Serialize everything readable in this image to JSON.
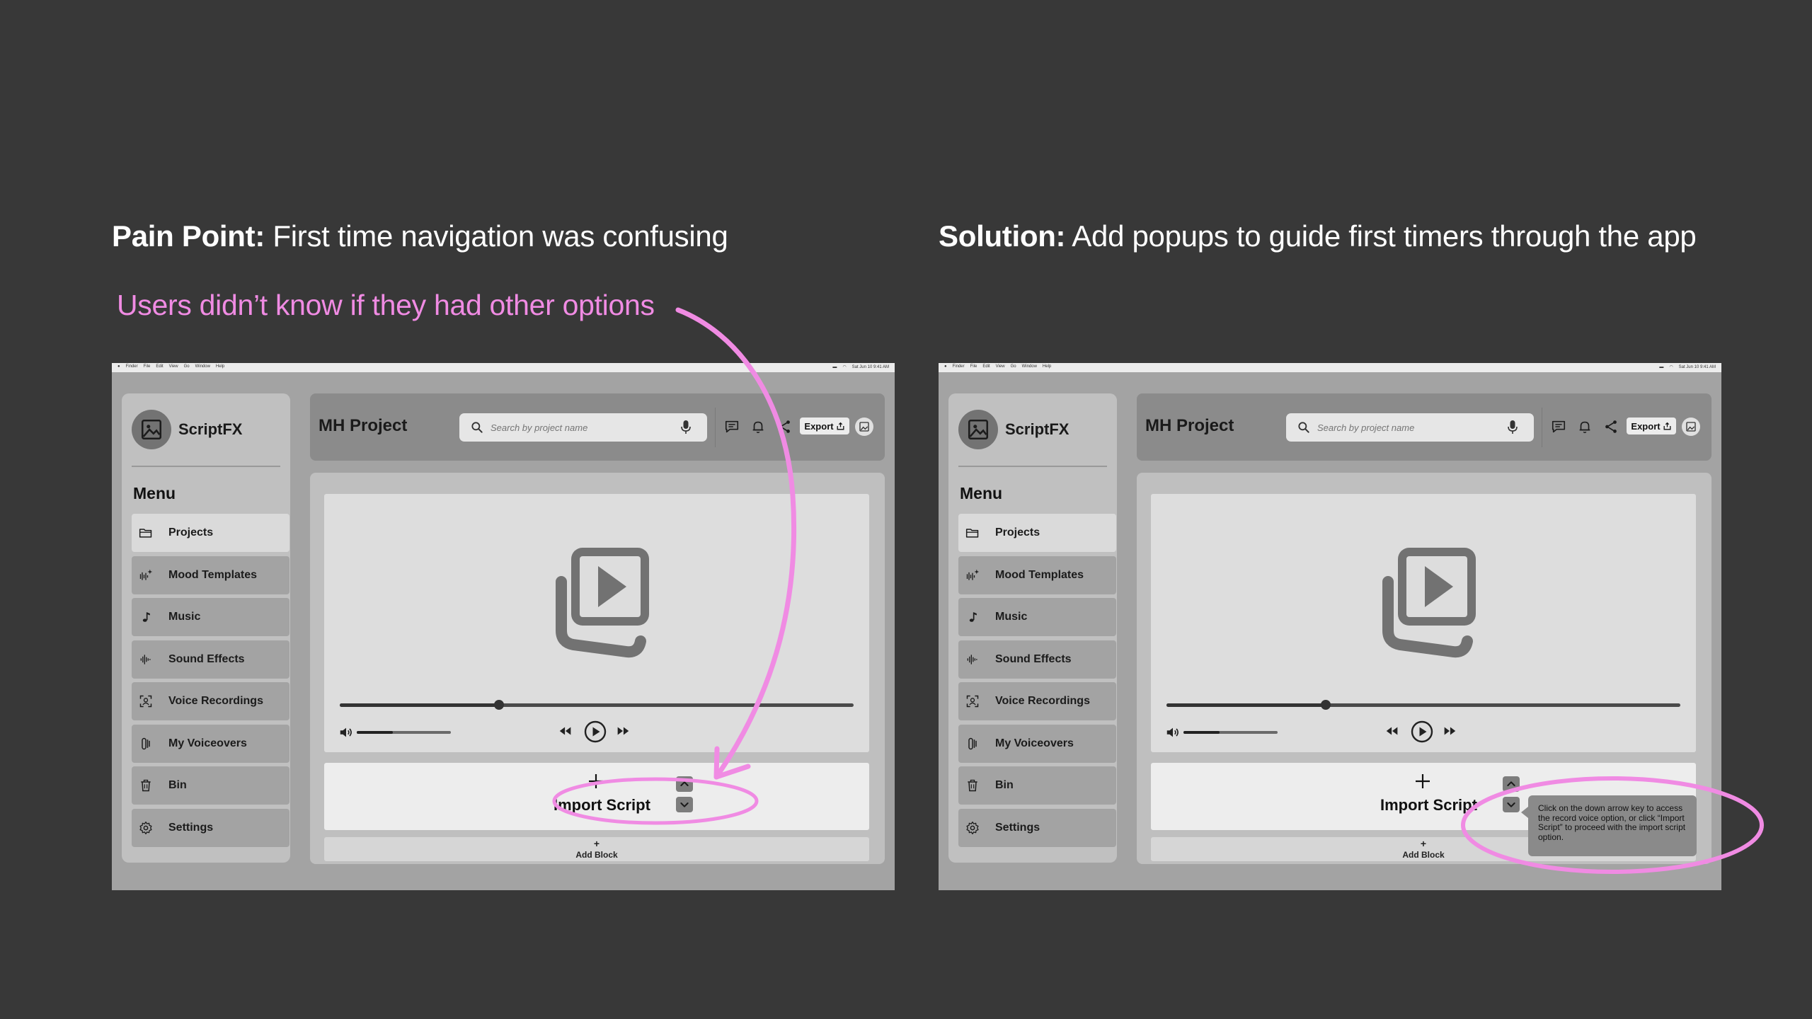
{
  "slide": {
    "pain": {
      "label": "Pain Point:",
      "text": " First time navigation was confusing"
    },
    "solution": {
      "label": "Solution:",
      "text": " Add popups to guide first timers through the app"
    },
    "pain_note": "Users didn’t know if they had other options",
    "annotation_color": "#f08be3"
  },
  "app": {
    "name": "ScriptFX",
    "project_title": "MH Project",
    "search_placeholder": "Search by project name",
    "export_label": "Export",
    "menu_heading": "Menu",
    "menu_items": [
      {
        "label": "Projects",
        "icon": "folder-icon"
      },
      {
        "label": "Mood Templates",
        "icon": "mood-wave-icon"
      },
      {
        "label": "Music",
        "icon": "music-note-icon"
      },
      {
        "label": "Sound Effects",
        "icon": "sound-wave-icon"
      },
      {
        "label": "Voice Recordings",
        "icon": "voice-scan-icon"
      },
      {
        "label": "My Voiceovers",
        "icon": "voiceover-icon"
      },
      {
        "label": "Bin",
        "icon": "trash-icon"
      },
      {
        "label": "Settings",
        "icon": "gear-icon"
      }
    ],
    "active_menu_item": "Projects",
    "playback_progress": 0.31,
    "volume_level": 0.38,
    "import_label": "Import Script",
    "add_block_plus": "+",
    "add_block_label": "Add Block",
    "tooltip_text": "Click on the down arrow key to access the record voice option, or click “Import Script” to proceed with the import script option.",
    "macbar_menus": [
      "",
      "Finder",
      "File",
      "Edit",
      "View",
      "Go",
      "Window",
      "Help"
    ],
    "macbar_status": "Sat Jun 10 9:41 AM"
  }
}
